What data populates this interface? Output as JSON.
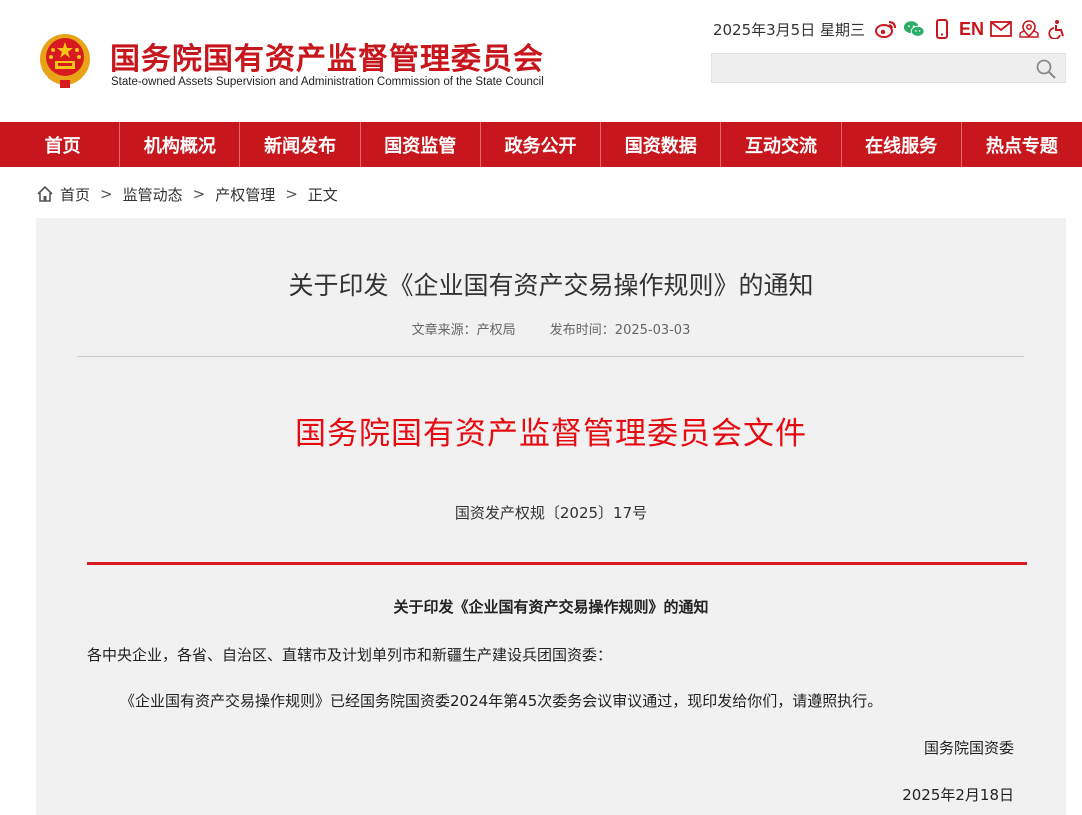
{
  "header": {
    "title_cn": "国务院国有资产监督管理委员会",
    "title_en": "State-owned Assets Supervision and Administration Commission of the State Council",
    "date": "2025年3月5日 星期三",
    "en_label": "EN",
    "icons": [
      "weibo-icon",
      "wechat-icon",
      "mobile-icon",
      "mail-icon",
      "location-icon",
      "accessibility-icon"
    ],
    "search": {
      "placeholder": ""
    }
  },
  "nav": {
    "items": [
      "首页",
      "机构概况",
      "新闻发布",
      "国资监管",
      "政务公开",
      "国资数据",
      "互动交流",
      "在线服务",
      "热点专题"
    ]
  },
  "breadcrumb": {
    "items": [
      "首页",
      "监管动态",
      "产权管理",
      "正文"
    ],
    "sep": ">"
  },
  "article": {
    "title": "关于印发《企业国有资产交易操作规则》的通知",
    "source": "文章来源：产权局",
    "publish_time": "发布时间：2025-03-03",
    "doc_header": "国务院国有资产监督管理委员会文件",
    "doc_number": "国资发产权规〔2025〕17号",
    "body_title": "关于印发《企业国有资产交易操作规则》的通知",
    "salutation": "各中央企业，各省、自治区、直辖市及计划单列市和新疆生产建设兵团国资委：",
    "paragraph": "《企业国有资产交易操作规则》已经国务院国资委2024年第45次委务会议审议通过，现印发给你们，请遵照执行。",
    "signature": "国务院国资委",
    "sign_date": "2025年2月18日"
  },
  "colors": {
    "brand_red": "#c8161d",
    "doc_red": "#e50b11",
    "panel_bg": "#f1f1f1"
  }
}
